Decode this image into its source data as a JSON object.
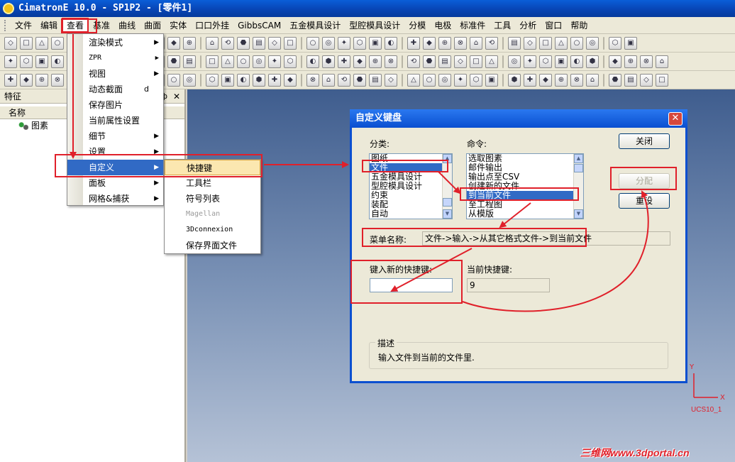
{
  "window": {
    "title": "CimatronE 10.0 - SP1P2 - [零件1]"
  },
  "menubar": [
    "文件",
    "编辑",
    "查看",
    "基准",
    "曲线",
    "曲面",
    "实体",
    "口口外挂",
    "GibbsCAM",
    "五金模具设计",
    "型腔模具设计",
    "分模",
    "电极",
    "标准件",
    "工具",
    "分析",
    "窗口",
    "帮助"
  ],
  "view_menu": [
    {
      "label": "渲染模式",
      "submenu": true
    },
    {
      "label": "ZPR",
      "submenu": true
    },
    {
      "label": "视图",
      "submenu": true
    },
    {
      "label": "动态截面",
      "shortcut": "d"
    },
    {
      "label": "保存图片"
    },
    {
      "label": "当前属性设置"
    },
    {
      "label": "细节",
      "submenu": true
    },
    {
      "label": "设置",
      "submenu": true
    },
    {
      "label": "自定义",
      "submenu": true,
      "selected": true
    },
    {
      "label": "面板",
      "submenu": true
    },
    {
      "label": "网格&捕获",
      "submenu": true
    }
  ],
  "customize_menu": [
    "快捷键",
    "工具栏",
    "符号列表",
    "Magellan",
    "3Dconnexion",
    "保存界面文件"
  ],
  "left_panel": {
    "title": "特征",
    "column": "名称",
    "tree_item": "图素",
    "pin": "ф",
    "close": "✕"
  },
  "dialog": {
    "title": "自定义键盘",
    "category_label": "分类:",
    "command_label": "命令:",
    "categories": [
      "图纸",
      "文件",
      "五金模具设计",
      "型腔模具设计",
      "约束",
      "装配",
      "自动"
    ],
    "commands": [
      "选取图素",
      "邮件输出",
      "输出点至CSV",
      "创建新的文件",
      "到当前文件",
      "至工程图",
      "从模版"
    ],
    "btn_close": "关闭",
    "btn_assign": "分配",
    "btn_reset": "重设",
    "menu_name_label": "菜单名称:",
    "menu_name_value": "文件->输入->从其它格式文件->到当前文件",
    "new_shortcut_label": "键入新的快捷键:",
    "current_shortcut_label": "当前快捷键:",
    "current_shortcut_value": "9",
    "desc_title": "描述",
    "desc_text": "输入文件到当前的文件里."
  },
  "ucs": {
    "label": "UCS10_1",
    "x": "X",
    "y": "Y"
  },
  "watermark": "三维网www.3dportal.cn",
  "colors": {
    "annotation": "#e0202a",
    "selection": "#316ac5",
    "titlebar": "#0a4fd0"
  }
}
